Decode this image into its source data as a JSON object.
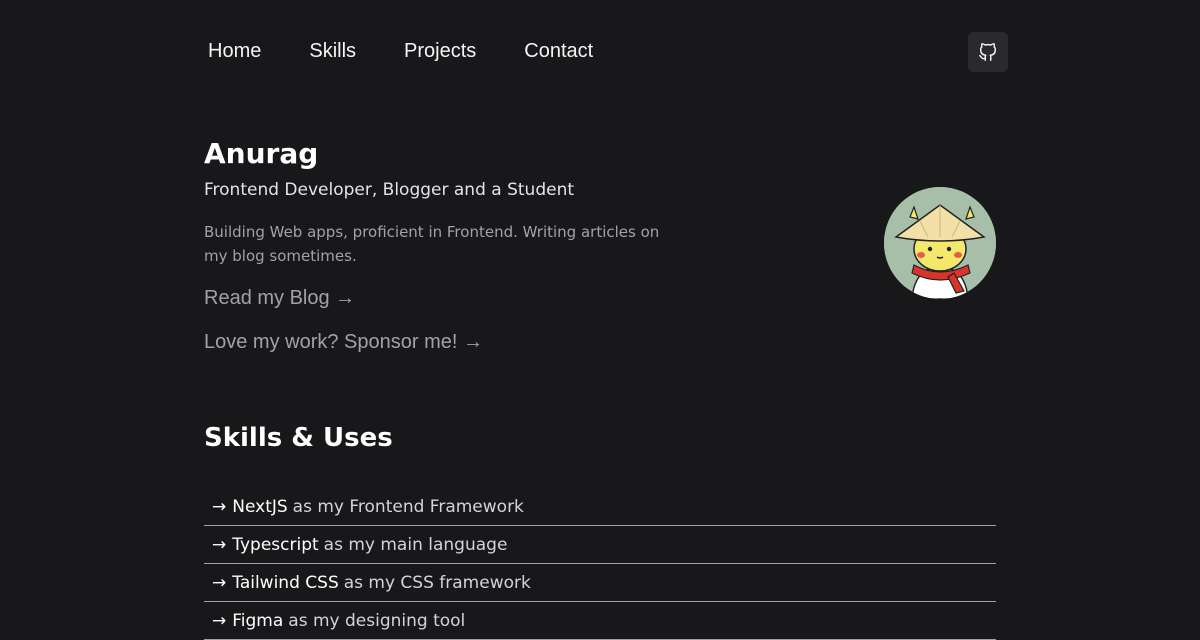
{
  "nav": {
    "items": [
      {
        "label": "Home"
      },
      {
        "label": "Skills"
      },
      {
        "label": "Projects"
      },
      {
        "label": "Contact"
      }
    ],
    "github_icon": "github-icon"
  },
  "hero": {
    "name": "Anurag",
    "role": "Frontend Developer, Blogger and a Student",
    "bio": "Building Web apps, proficient in Frontend. Writing articles on my blog sometimes.",
    "blog_link": "Read my Blog →",
    "sponsor_link": "Love my work? Sponsor me! →",
    "avatar_icon": "avatar-character-illustration"
  },
  "skills": {
    "title": "Skills & Uses",
    "arrow": "→",
    "items": [
      {
        "tool": "NextJS",
        "desc": "as my Frontend Framework"
      },
      {
        "tool": "Typescript",
        "desc": "as my main language"
      },
      {
        "tool": "Tailwind CSS",
        "desc": "as my CSS framework"
      },
      {
        "tool": "Figma",
        "desc": "as my designing tool"
      }
    ]
  },
  "colors": {
    "background": "#18181b",
    "text_primary": "#ffffff",
    "text_muted": "#a1a1aa",
    "divider": "#a1a1aa",
    "avatar_bg": "#a7bfa9"
  }
}
